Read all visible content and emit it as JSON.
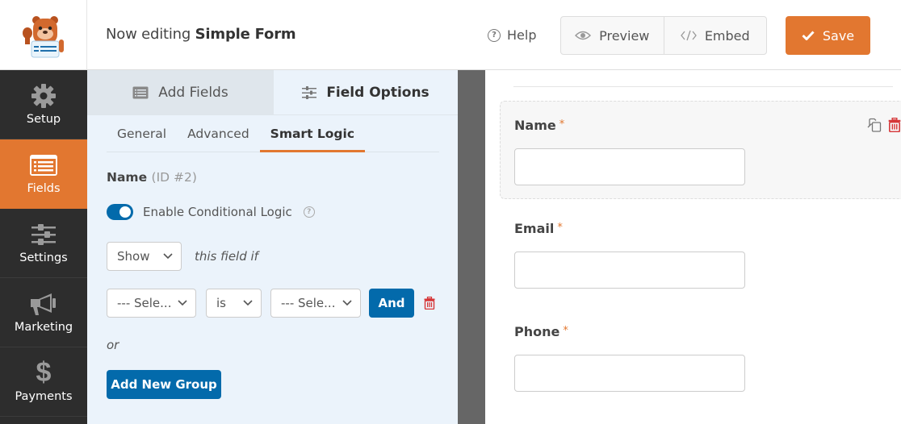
{
  "header": {
    "logo_alt": "WPForms mascot",
    "title_prefix": "Now editing",
    "form_name": "Simple Form",
    "help_label": "Help",
    "help_icon": "question-circle-icon",
    "preview_label": "Preview",
    "preview_icon": "eye-icon",
    "embed_label": "Embed",
    "embed_icon": "code-icon",
    "save_label": "Save",
    "save_icon": "checkmark-icon"
  },
  "sidebar": {
    "items": [
      {
        "label": "Setup",
        "icon": "gear-icon",
        "active": false
      },
      {
        "label": "Fields",
        "icon": "fields-list-icon",
        "active": true
      },
      {
        "label": "Settings",
        "icon": "sliders-icon",
        "active": false
      },
      {
        "label": "Marketing",
        "icon": "megaphone-icon",
        "active": false
      },
      {
        "label": "Payments",
        "icon": "dollar-icon",
        "active": false
      }
    ]
  },
  "panel": {
    "tabs": [
      {
        "label": "Add Fields",
        "icon": "list-icon",
        "active": false
      },
      {
        "label": "Field Options",
        "icon": "sliders-icon",
        "active": true
      }
    ],
    "subtabs": [
      {
        "label": "General",
        "active": false
      },
      {
        "label": "Advanced",
        "active": false
      },
      {
        "label": "Smart Logic",
        "active": true
      }
    ],
    "field_name": "Name",
    "field_id": "(ID #2)",
    "conditional_logic": {
      "label": "Enable Conditional Logic",
      "enabled": true
    },
    "action_select": "Show",
    "action_suffix": "this field if",
    "rule": {
      "field_select": "--- Sele...",
      "operator_select": "is",
      "value_select": "--- Sele...",
      "and_label": "And"
    },
    "or_label": "or",
    "add_group_label": "Add New Group"
  },
  "preview": {
    "fields": [
      {
        "label": "Name",
        "required": "*",
        "value": ""
      },
      {
        "label": "Email",
        "required": "*",
        "value": ""
      },
      {
        "label": "Phone",
        "required": "*",
        "value": ""
      }
    ]
  },
  "colors": {
    "accent_orange": "#e27730",
    "primary_blue": "#036aab",
    "delete_red": "#d63638",
    "sidebar_bg": "#2d2d2d",
    "panel_bg": "#ebf3fb"
  }
}
